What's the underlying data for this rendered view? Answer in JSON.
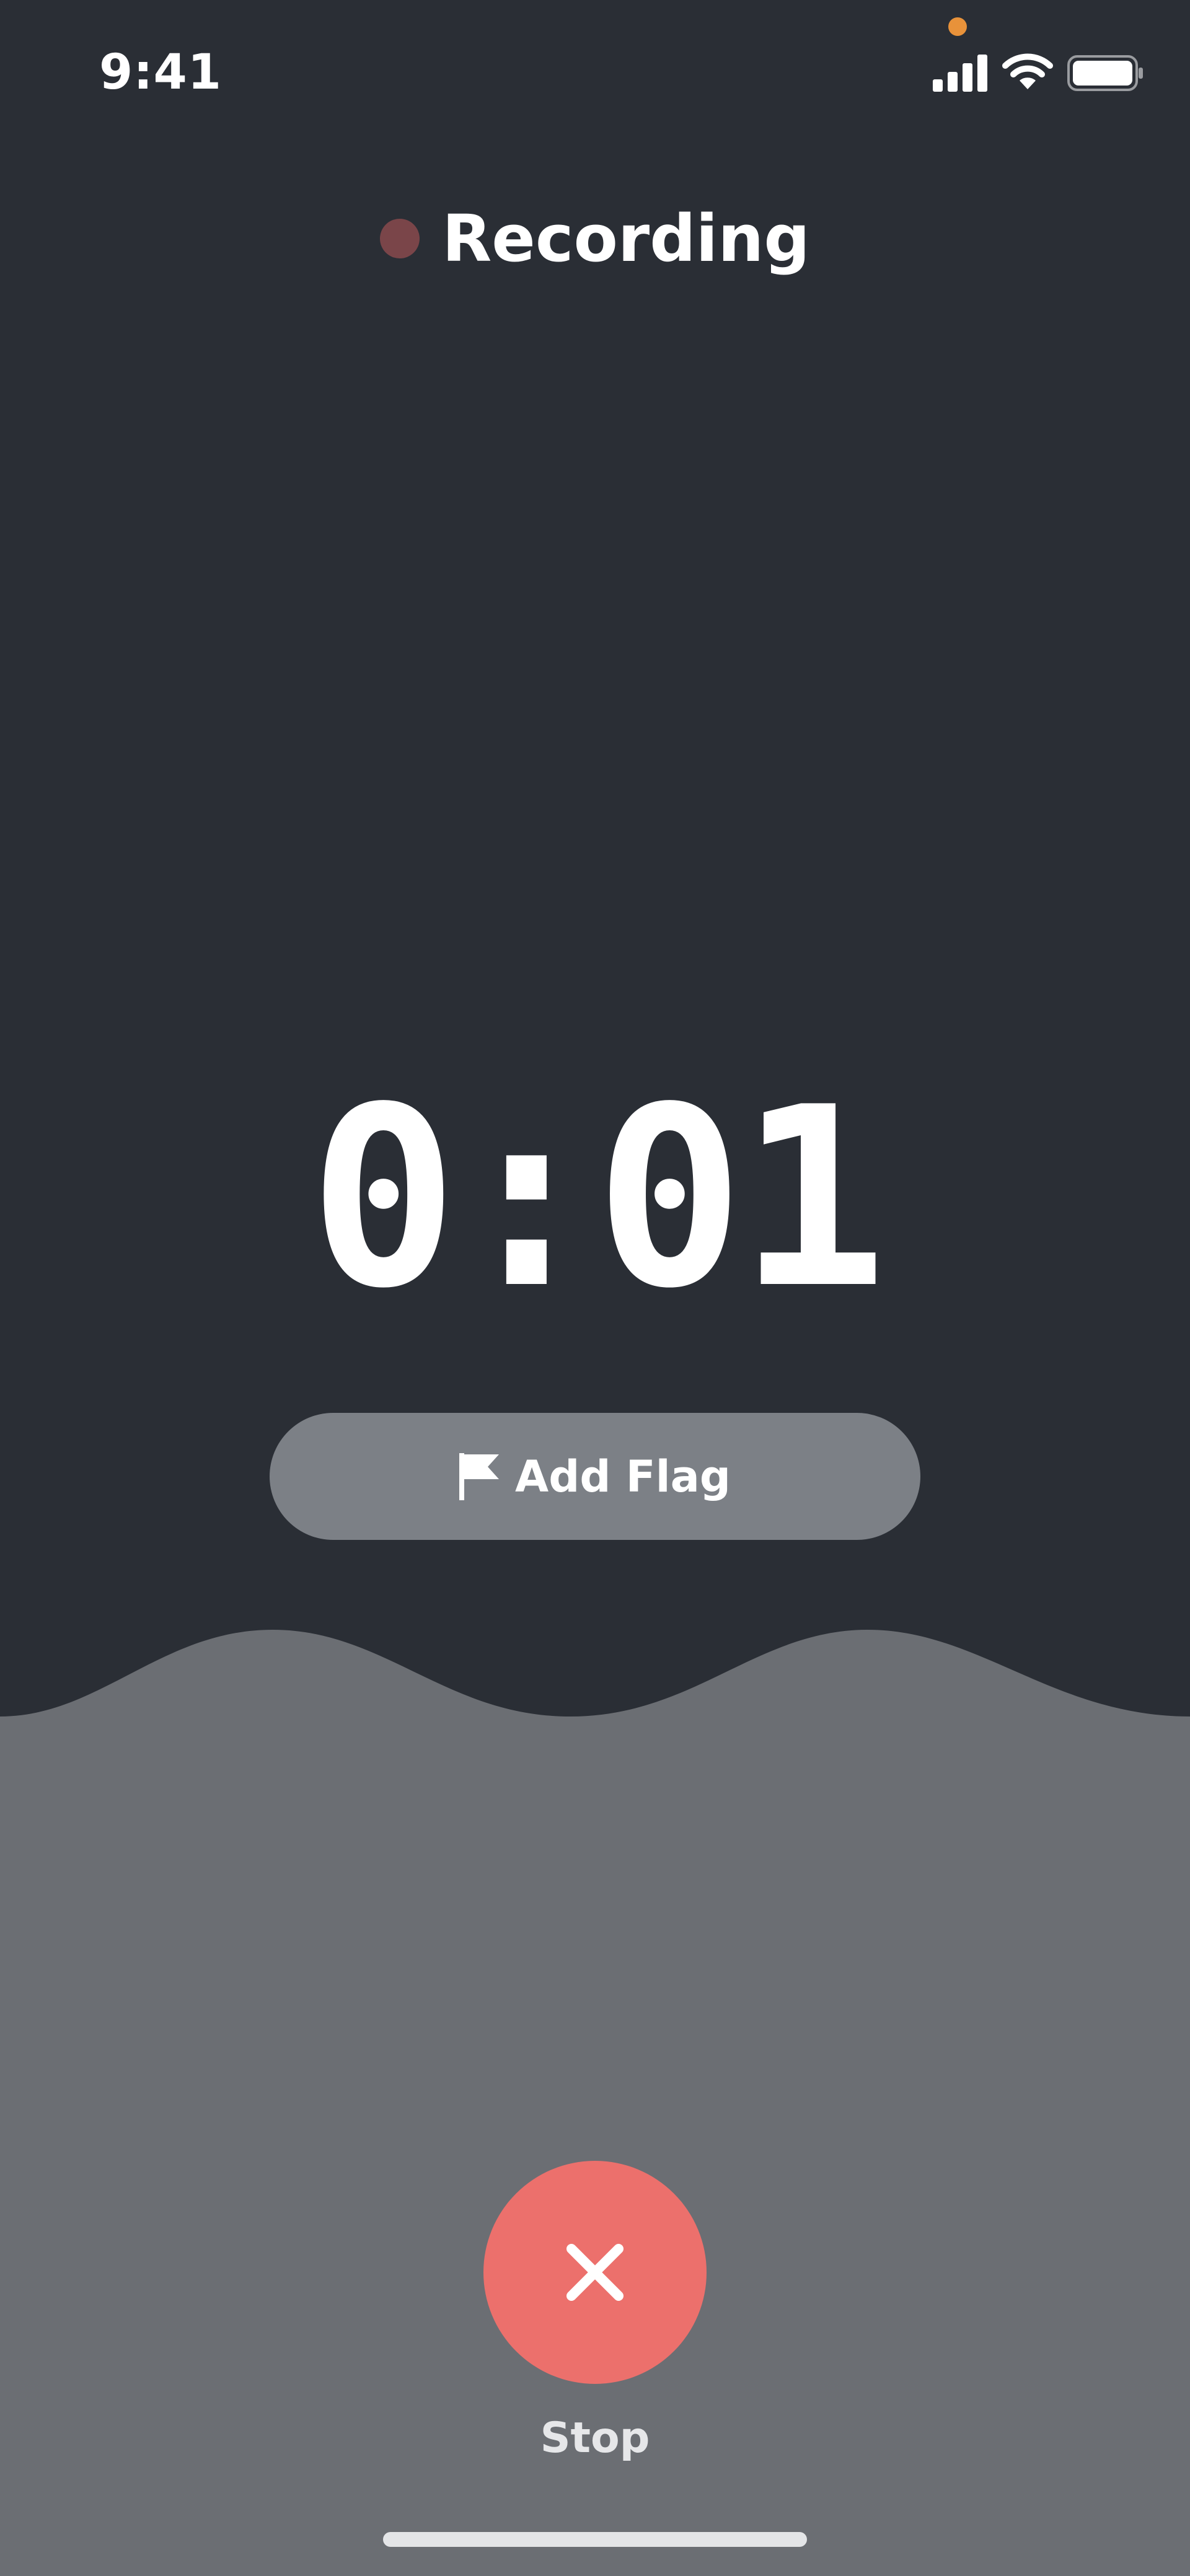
{
  "status_bar": {
    "time": "9:41",
    "icons": [
      "signal-icon",
      "wifi-icon",
      "battery-icon"
    ],
    "privacy_indicator_color": "#e8923a"
  },
  "header": {
    "title": "Recording",
    "dot_color": "#7a4549"
  },
  "timer": {
    "elapsed": "0:01"
  },
  "flag_button": {
    "label": "Add Flag",
    "icon": "flag-icon"
  },
  "stop_button": {
    "label": "Stop",
    "icon": "close-icon",
    "color": "#ec706c"
  },
  "colors": {
    "background": "#2a2e35",
    "panel": "#6b6e73",
    "flag_button": "#7c8086",
    "text": "#ffffff"
  }
}
